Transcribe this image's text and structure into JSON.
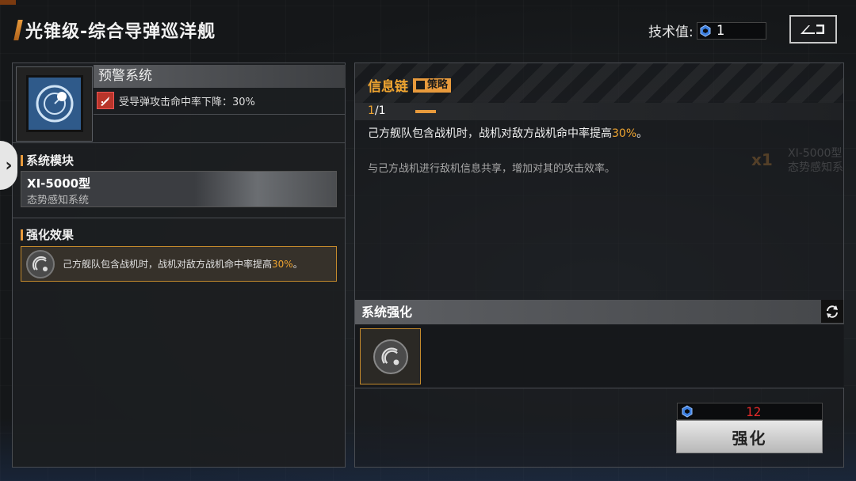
{
  "header": {
    "title": "光锥级-综合导弹巡洋舰",
    "tech_label": "技术值:",
    "tech_value": "1"
  },
  "left": {
    "system_name": "预警系统",
    "system_desc": "受导弹攻击命中率下降：30%",
    "module_section_title": "系统模块",
    "module_name": "XI-5000型",
    "module_sub": "态势感知系统",
    "effect_section_title": "强化效果",
    "effect_text_before": "己方舰队包含战机时，战机对敌方战机命中率提高",
    "effect_text_highlight": "30%",
    "effect_text_after": "。"
  },
  "right": {
    "info_title": "信息链",
    "info_tag": "策略",
    "level_current": "1",
    "level_max": "/1",
    "info_main_before": "己方舰队包含战机时，战机对敌方战机命中率提高",
    "info_main_highlight": "30%",
    "info_main_after": "。",
    "info_sub": "与己方战机进行敌机信息共享，增加对其的攻击效率。",
    "bg_x": "x1",
    "bg_module_name": "XI-5000型",
    "bg_module_sub": "态势感知系",
    "enhance_header": "系统强化",
    "cost_value": "12",
    "enhance_button": "强化"
  },
  "colors": {
    "accent": "#e89a3c",
    "highlight": "#f0a530",
    "cost_insufficient": "#e02a2a"
  },
  "icons": [
    "hexagon-chip-icon",
    "back-icon",
    "radar-icon",
    "missile-icon",
    "chevron-right-icon",
    "signal-icon",
    "refresh-icon"
  ]
}
